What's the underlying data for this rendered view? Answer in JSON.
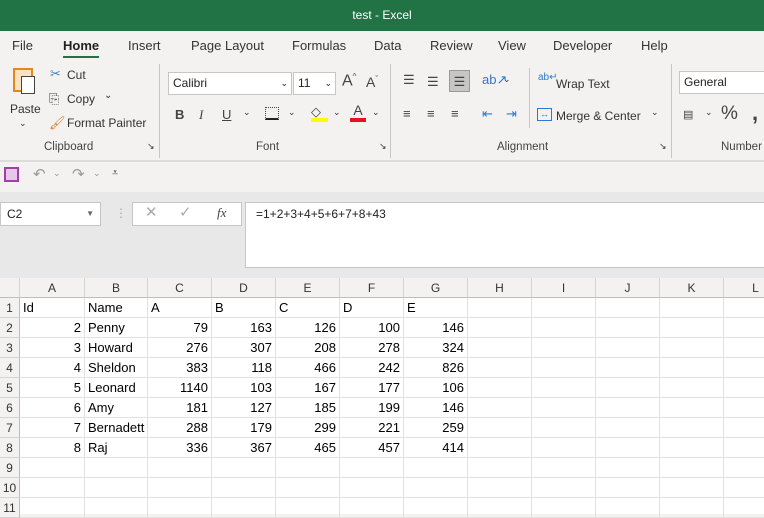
{
  "title": "test  -  Excel",
  "menu": [
    "File",
    "Home",
    "Insert",
    "Page Layout",
    "Formulas",
    "Data",
    "Review",
    "View",
    "Developer",
    "Help"
  ],
  "clipboard": {
    "paste": "Paste",
    "cut": "Cut",
    "copy": "Copy",
    "format_painter": "Format Painter",
    "group": "Clipboard"
  },
  "font": {
    "name": "Calibri",
    "size": "11",
    "group": "Font",
    "bold": "B",
    "italic": "I",
    "underline": "U"
  },
  "alignment": {
    "wrap": "Wrap Text",
    "merge": "Merge & Center",
    "group": "Alignment"
  },
  "number": {
    "format": "General",
    "group": "Number",
    "percent": "%",
    "comma": ","
  },
  "formula_bar": {
    "name_box": "C2",
    "formula": "=1+2+3+4+5+6+7+8+43",
    "fx": "fx"
  },
  "columns": [
    "A",
    "B",
    "C",
    "D",
    "E",
    "F",
    "G",
    "H",
    "I",
    "J",
    "K",
    "L"
  ],
  "rows": [
    "1",
    "2",
    "3",
    "4",
    "5",
    "6",
    "7",
    "8",
    "9",
    "10",
    "11"
  ],
  "cells": [
    [
      "Id",
      "Name",
      "A",
      "B",
      "C",
      "D",
      "E"
    ],
    [
      "2",
      "Penny",
      "79",
      "163",
      "126",
      "100",
      "146"
    ],
    [
      "3",
      "Howard",
      "276",
      "307",
      "208",
      "278",
      "324"
    ],
    [
      "4",
      "Sheldon",
      "383",
      "118",
      "466",
      "242",
      "826"
    ],
    [
      "5",
      "Leonard",
      "1140",
      "103",
      "167",
      "177",
      "106"
    ],
    [
      "6",
      "Amy",
      "181",
      "127",
      "185",
      "199",
      "146"
    ],
    [
      "7",
      "Bernadett",
      "288",
      "179",
      "299",
      "221",
      "259"
    ],
    [
      "8",
      "Raj",
      "336",
      "367",
      "465",
      "457",
      "414"
    ]
  ]
}
